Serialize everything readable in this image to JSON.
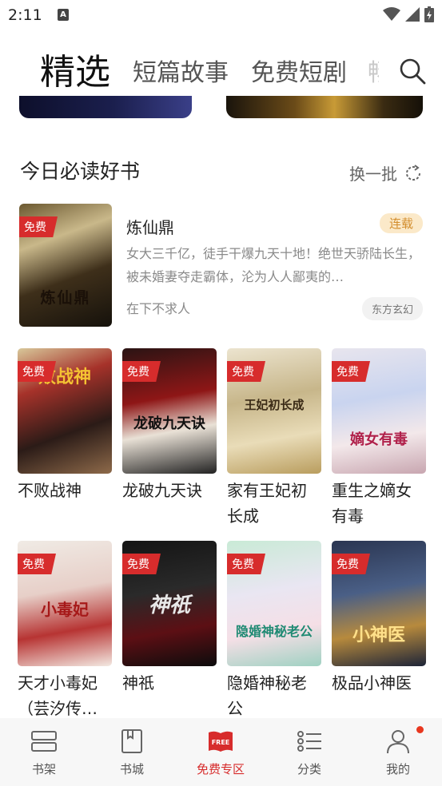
{
  "status_bar": {
    "time": "2:11",
    "notification_icon": "A"
  },
  "top_tabs": [
    {
      "label": "精选",
      "active": true
    },
    {
      "label": "短篇故事",
      "active": false
    },
    {
      "label": "免费短剧",
      "active": false
    },
    {
      "label": "畅",
      "active": false
    }
  ],
  "section": {
    "title": "今日必读好书",
    "refresh_label": "换一批"
  },
  "featured_book": {
    "cover_title": "炼仙鼎",
    "free_badge": "免费",
    "title": "炼仙鼎",
    "status": "连载",
    "description": "女大三千亿，徒手干爆九天十地！绝世天骄陆长生，被未婚妻夺走霸体，沦为人人鄙夷的…",
    "author": "在下不求人",
    "genre": "东方玄幻"
  },
  "books": [
    {
      "title": "不败战神",
      "free_badge": "免费",
      "cover_text": "败战神"
    },
    {
      "title": "龙破九天诀",
      "free_badge": "免费",
      "cover_text": "龙破九天诀"
    },
    {
      "title": "家有王妃初长成",
      "free_badge": "免费",
      "cover_text": "王妃初长成"
    },
    {
      "title": "重生之嫡女有毒",
      "free_badge": "免费",
      "cover_text": "嫡女有毒"
    },
    {
      "title": "天才小毒妃（芸汐传…",
      "free_badge": "免费",
      "cover_text": "小毒妃"
    },
    {
      "title": "神祇",
      "free_badge": "免费",
      "cover_text": "神祇"
    },
    {
      "title": "隐婚神秘老公",
      "free_badge": "免费",
      "cover_text": "隐婚神秘老公"
    },
    {
      "title": "极品小神医",
      "free_badge": "免费",
      "cover_text": "小神医"
    }
  ],
  "bottom_nav": [
    {
      "label": "书架",
      "icon": "bookshelf-icon",
      "active": false
    },
    {
      "label": "书城",
      "icon": "book-icon",
      "active": false
    },
    {
      "label": "免费专区",
      "icon": "free-icon",
      "active": true,
      "icon_text": "FREE"
    },
    {
      "label": "分类",
      "icon": "category-icon",
      "active": false
    },
    {
      "label": "我的",
      "icon": "profile-icon",
      "active": false
    }
  ],
  "colors": {
    "accent": "#d72c2c",
    "serial_badge_bg": "#fbe9c9",
    "serial_badge_text": "#d38e2e"
  }
}
